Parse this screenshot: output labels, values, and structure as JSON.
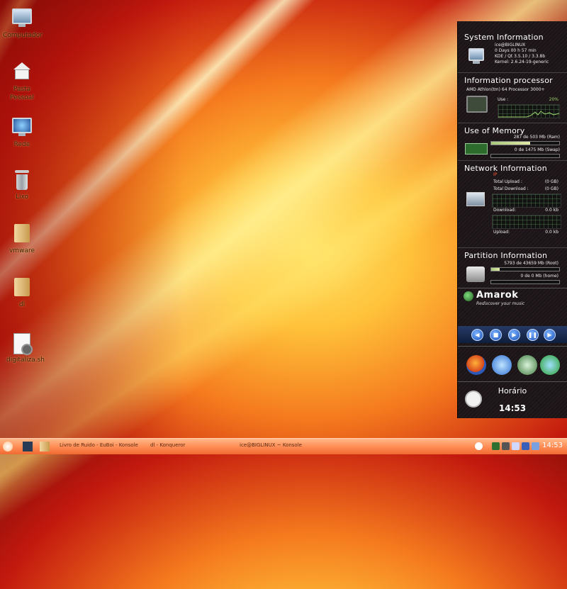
{
  "desktop": {
    "icons": [
      {
        "label": "Computador",
        "icon": "computer-icon"
      },
      {
        "label": "Pasta Pessoal",
        "icon": "home-folder-icon"
      },
      {
        "label": "Rede",
        "icon": "network-icon"
      },
      {
        "label": "Lixo",
        "icon": "trash-icon"
      },
      {
        "label": "vmware",
        "icon": "folder-icon"
      },
      {
        "label": "dl",
        "icon": "folder-icon"
      },
      {
        "label": "digitaliza.sh",
        "icon": "script-icon"
      }
    ]
  },
  "widgets": {
    "system": {
      "title": "System Information",
      "user": "ice@BIGLINUX",
      "uptime": "0 Days 00 h 57 min",
      "kde": "KDE / Qt   3.5.10 / 3.3.8b",
      "kernel": "Kernel: 2.6.24-19-generic"
    },
    "processor": {
      "title": "Information processor",
      "model": "AMD Athlon(tm) 64 Processor 3000+",
      "use_label": "Use :",
      "use_value": "20%",
      "use_fraction": 0.2
    },
    "memory": {
      "title": "Use of Memory",
      "ram": "287  de  503 Mb (Ram)",
      "ram_fraction": 0.57,
      "swap": "0  de  1475 Mb (Swap)",
      "swap_fraction": 0.0
    },
    "network": {
      "title": "Network Information",
      "ip_label": "IP",
      "upload_total_label": "Total Upload :",
      "upload_total_value": "(0 GB)",
      "download_total_label": "Total Download :",
      "download_total_value": "(0 GB)",
      "download_label": "Download:",
      "download_value": "0.0 kb",
      "upload_label": "Upload:",
      "upload_value": "0.0 kb"
    },
    "partition": {
      "title": "Partition Information",
      "root": "5793  de  43659 Mb (Root)",
      "root_fraction": 0.13,
      "home": "0  de  0 Mb (home)",
      "home_fraction": 0.0
    },
    "amarok": {
      "name": "Amarok",
      "tagline": "Rediscover your music",
      "controls": [
        "previous-icon",
        "stop-icon",
        "play-icon",
        "pause-icon",
        "next-icon"
      ]
    },
    "apps": [
      "firefox-icon",
      "network-globe-icon",
      "gnome-icon",
      "messenger-icon"
    ],
    "clock": {
      "title": "Horário",
      "time": "14:53"
    }
  },
  "taskbar": {
    "items": [
      "Livro de Ruido - EuBoi - Konsole",
      "dl - Konqueror",
      "ice@BIGLINUX ~ Konsole"
    ],
    "clock": "14:53"
  },
  "colors": {
    "panel": "#1b1416",
    "taskbar": "#ff8a52",
    "accent_green": "#a9c97e"
  }
}
